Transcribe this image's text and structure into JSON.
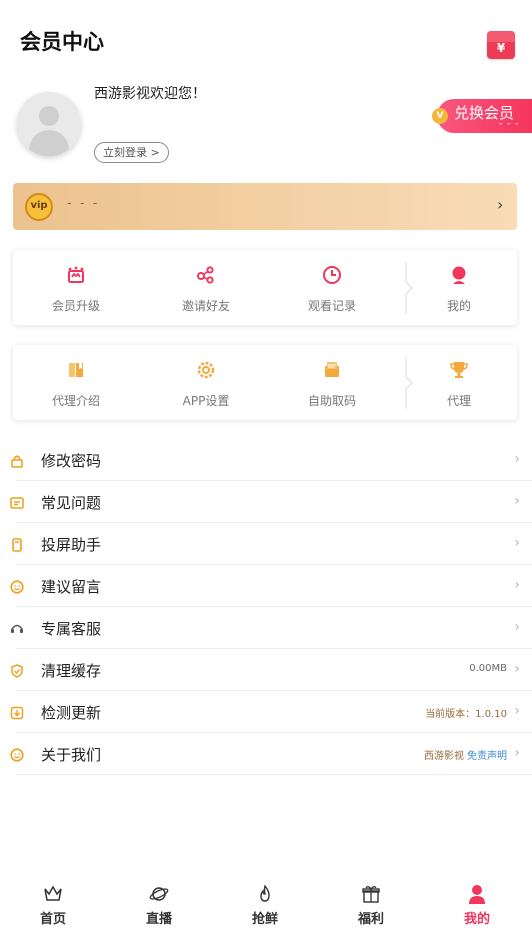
{
  "header": {
    "title": "会员中心",
    "redpack_icon": "red-envelope-icon",
    "redpack_symbol": "¥"
  },
  "profile": {
    "welcome": "西游影视欢迎您！",
    "login_label": "立刻登录",
    "login_chevron": ">",
    "exchange_label": "兑换会员",
    "exchange_badge": "V",
    "exchange_sub": "- - -"
  },
  "vip": {
    "badge": "vip",
    "status": "- - -",
    "chevron": "›"
  },
  "grid1": [
    {
      "label": "会员升级",
      "icon": "crown-frame-icon"
    },
    {
      "label": "邀请好友",
      "icon": "share-icon"
    },
    {
      "label": "观看记录",
      "icon": "clock-icon"
    },
    {
      "label": "我的",
      "icon": "user-icon"
    }
  ],
  "grid2": [
    {
      "label": "代理介绍",
      "icon": "book-icon"
    },
    {
      "label": "APP设置",
      "icon": "gear-icon"
    },
    {
      "label": "自助取码",
      "icon": "mail-icon"
    },
    {
      "label": "代理",
      "icon": "trophy-icon"
    }
  ],
  "menu": [
    {
      "label": "修改密码",
      "icon": "lock-icon",
      "right": ""
    },
    {
      "label": "常见问题",
      "icon": "faq-icon",
      "right": ""
    },
    {
      "label": "投屏助手",
      "icon": "phone-icon",
      "right": ""
    },
    {
      "label": "建议留言",
      "icon": "smile-icon",
      "right": ""
    },
    {
      "label": "专属客服",
      "icon": "headset-icon",
      "right": ""
    },
    {
      "label": "清理缓存",
      "icon": "shield-check-icon",
      "right": "0.00MB"
    },
    {
      "label": "检测更新",
      "icon": "download-icon",
      "right": "当前版本：1.0.10"
    },
    {
      "label": "关于我们",
      "icon": "smile-icon",
      "right": "西游影视",
      "right2": "免责声明"
    }
  ],
  "tabs": [
    {
      "label": "首页",
      "icon": "crown-icon",
      "active": false
    },
    {
      "label": "直播",
      "icon": "planet-icon",
      "active": false
    },
    {
      "label": "抢鲜",
      "icon": "fire-icon",
      "active": false
    },
    {
      "label": "福利",
      "icon": "gift-icon",
      "active": false
    },
    {
      "label": "我的",
      "icon": "user-icon",
      "active": true
    }
  ],
  "colors": {
    "accent": "#f0365c",
    "gold": "#d18c18",
    "vip_bg": "#ecc28e"
  }
}
